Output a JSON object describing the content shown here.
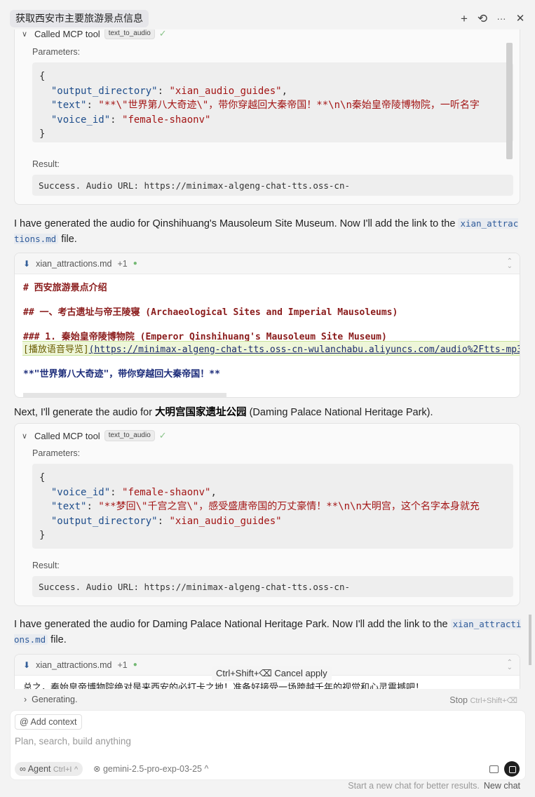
{
  "header": {
    "title": "获取西安市主要旅游景点信息",
    "new_icon": "+",
    "history_icon": "⟲",
    "more_icon": "···",
    "close_icon": "✕"
  },
  "tool_call_1": {
    "label": "Called MCP tool",
    "tool": "text_to_audio",
    "params_label": "Parameters:",
    "params": [
      {
        "key": "\"output_directory\"",
        "value": "\"xian_audio_guides\""
      },
      {
        "key": "\"text\"",
        "value": "\"**\\\"世界第八大奇迹\\\"，带你穿越回大秦帝国！**\\n\\n秦始皇帝陵博物院，一听名字"
      },
      {
        "key": "\"voice_id\"",
        "value": "\"female-shaonv\""
      }
    ],
    "result_label": "Result:",
    "result": "Success. Audio URL: https://minimax-algeng-chat-tts.oss-cn-"
  },
  "msg_1": {
    "before": "I have generated the audio for Qinshihuang's Mausoleum Site Museum. Now I'll add the link to the ",
    "code": "xian_attractions.md",
    "after": " file."
  },
  "file_1": {
    "name": "xian_attractions.md",
    "change": "+1",
    "line1": "# 西安旅游景点介绍",
    "line2": "## 一、考古遗址与帝王陵寝 (Archaeological Sites and Imperial Mausoleums)",
    "line3": "### 1. 秦始皇帝陵博物院 (Emperor Qinshihuang's Mausoleum Site Museum)",
    "link_text": "[播放语音导览]",
    "link_url": "(https://minimax-algeng-chat-tts.oss-cn-wulanchabu.aliyuncs.com/audio%2Ftts-mp3-20250",
    "line5": "**\"世界第八大奇迹\"，带你穿越回大秦帝国！**"
  },
  "msg_2": {
    "before": "Next, I'll generate the audio for ",
    "bold": "大明宫国家遗址公园",
    "after": " (Daming Palace National Heritage Park)."
  },
  "tool_call_2": {
    "label": "Called MCP tool",
    "tool": "text_to_audio",
    "params_label": "Parameters:",
    "params": [
      {
        "key": "\"voice_id\"",
        "value": "\"female-shaonv\""
      },
      {
        "key": "\"text\"",
        "value": "\"**梦回\\\"千宫之宫\\\"，感受盛唐帝国的万丈豪情！**\\n\\n大明宫，这个名字本身就充"
      },
      {
        "key": "\"output_directory\"",
        "value": "\"xian_audio_guides\""
      }
    ],
    "result_label": "Result:",
    "result": "Success. Audio URL: https://minimax-algeng-chat-tts.oss-cn-"
  },
  "msg_3": {
    "before": "I have generated the audio for Daming Palace National Heritage Park. Now I'll add the link to the ",
    "code": "xian_attractions.md",
    "after": " file."
  },
  "file_2": {
    "name": "xian_attractions.md",
    "change": "+1",
    "line1": "总之，秦始皇帝博物院绝对是来西安的必打卡之地！准备好接受一场跨越千年的视觉和心灵震撼吧！"
  },
  "cancel_tip": "Ctrl+Shift+⌫ Cancel apply",
  "composer": {
    "generating": "Generating.",
    "stop": "Stop",
    "stop_shortcut": "Ctrl+Shift+⌫",
    "add_context": "Add context",
    "placeholder": "Plan, search, build anything",
    "agent": "Agent",
    "agent_shortcut": "Ctrl+I",
    "model": "gemini-2.5-pro-exp-03-25"
  },
  "footer": {
    "hint": "Start a new chat for better results.",
    "new_chat": "New chat"
  }
}
